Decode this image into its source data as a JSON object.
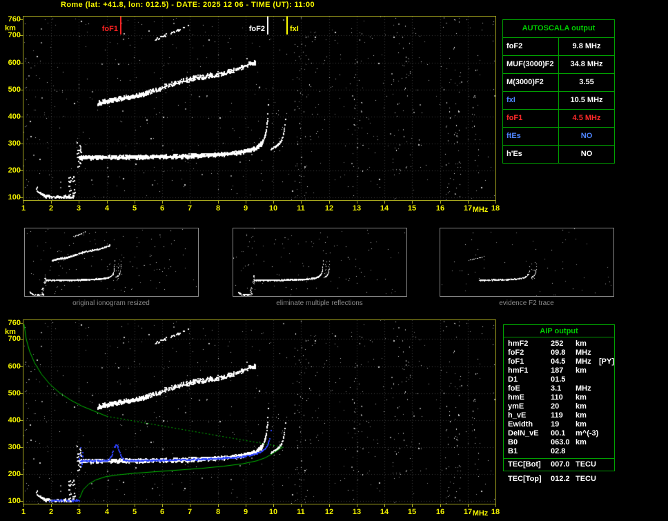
{
  "title": "Rome (lat: +41.8, lon: 012.5) - DATE: 2025 12 06 - TIME (UT): 11:00",
  "colors": {
    "background": "#000000",
    "axis": "#a9a91f",
    "axis_text": "#f2f200",
    "grid": "#3d3d3d",
    "trace_white": "#ffffff",
    "trace_blue": "#2d43ff",
    "profile_green": "#00c000",
    "panel_green": "#00a000",
    "panel_header_green": "#00cc00",
    "red": "#ff2a2a",
    "blue_text": "#4f86ff",
    "caption_gray": "#8a8a8a",
    "title_yellow": "#f8f800"
  },
  "autoscala": {
    "header": "AUTOSCALA output",
    "rows": [
      {
        "label": "foF2",
        "value": "9.8 MHz",
        "label_color": "#ffffff",
        "value_color": "#ffffff"
      },
      {
        "label": "MUF(3000)F2",
        "value": "34.8 MHz",
        "label_color": "#ffffff",
        "value_color": "#ffffff"
      },
      {
        "label": "M(3000)F2",
        "value": "3.55",
        "label_color": "#ffffff",
        "value_color": "#ffffff"
      },
      {
        "label": "fxI",
        "value": "10.5 MHz",
        "label_color": "#4f86ff",
        "value_color": "#ffffff"
      },
      {
        "label": "foF1",
        "value": "4.5 MHz",
        "label_color": "#ff2a2a",
        "value_color": "#ff2a2a"
      },
      {
        "label": "ftEs",
        "value": "NO",
        "label_color": "#4f86ff",
        "value_color": "#4f86ff"
      },
      {
        "label": "h'Es",
        "value": "NO",
        "label_color": "#ffffff",
        "value_color": "#ffffff"
      }
    ]
  },
  "aip": {
    "header": "AIP output",
    "rows": [
      {
        "label": "hmF2",
        "value": "252",
        "unit": "km",
        "extra": ""
      },
      {
        "label": "foF2",
        "value": "09.8",
        "unit": "MHz",
        "extra": ""
      },
      {
        "label": "foF1",
        "value": "04.5",
        "unit": "MHz",
        "extra": "[PY]"
      },
      {
        "label": "hmF1",
        "value": "187",
        "unit": "km",
        "extra": ""
      },
      {
        "label": "D1",
        "value": "01.5",
        "unit": "",
        "extra": ""
      },
      {
        "label": "foE",
        "value": "3.1",
        "unit": "MHz",
        "extra": ""
      },
      {
        "label": "hmE",
        "value": "110",
        "unit": "km",
        "extra": ""
      },
      {
        "label": "ymE",
        "value": "20",
        "unit": "km",
        "extra": ""
      },
      {
        "label": "h_vE",
        "value": "119",
        "unit": "km",
        "extra": ""
      },
      {
        "label": "Ewidth",
        "value": "19",
        "unit": "km",
        "extra": ""
      },
      {
        "label": "DelN_vE",
        "value": "00.1",
        "unit": "m^(-3)",
        "extra": ""
      },
      {
        "label": "B0",
        "value": "063.0",
        "unit": "km",
        "extra": ""
      },
      {
        "label": "B1",
        "value": "02.8",
        "unit": "",
        "extra": ""
      }
    ],
    "tec_rows": [
      {
        "label": "TEC[Bot]",
        "value": "007.0",
        "unit": "TECU"
      },
      {
        "label": "TEC[Top]",
        "value": "012.2",
        "unit": "TECU"
      }
    ]
  },
  "thumbnails": [
    {
      "caption": "original ionogram resized"
    },
    {
      "caption": "eliminate multiple reflections"
    },
    {
      "caption": "evidence F2 trace"
    }
  ],
  "chart_data": {
    "type": "scatter",
    "title": "ionogram",
    "xlabel": "MHz",
    "ylabel": "km",
    "xlim": [
      1,
      18
    ],
    "ylim": [
      90,
      770
    ],
    "x_ticks": [
      1,
      2,
      3,
      4,
      5,
      6,
      7,
      8,
      9,
      10,
      11,
      12,
      13,
      14,
      15,
      16,
      17,
      18
    ],
    "y_ticks": [
      760,
      700,
      600,
      500,
      400,
      300,
      200,
      100
    ],
    "markers": [
      {
        "label": "foF1",
        "f": 4.5,
        "color": "#ff2222",
        "side": "left"
      },
      {
        "label": "foF2",
        "f": 9.8,
        "color": "#ffffff",
        "side": "left"
      },
      {
        "label": "fxI",
        "f": 10.5,
        "color": "#ffff00",
        "side": "right"
      }
    ],
    "foF2_asymptote": 9.82,
    "fxI_asymptote": 10.47,
    "noise_bands": [
      10.9,
      11.2,
      13.05,
      14.45,
      14.8,
      16.25,
      16.6,
      17.3
    ],
    "second_hop": {
      "f_start": 3.65,
      "f_end": 9.35,
      "h_start": 443,
      "h_end": 597
    },
    "third_hop": {
      "f_start": 5.75,
      "f_end": 6.95,
      "h_start": 688,
      "h_end": 736
    },
    "e_region": {
      "f_start": 1.45,
      "f_end": 2.8,
      "h": 103
    },
    "restored_trace": {
      "f_start": 3.05,
      "f_end": 10.1,
      "base": 236,
      "a": 14,
      "fc": 9.95,
      "bump_f": 4.32,
      "bump_amp": 58,
      "bump_w": 0.16,
      "e_f_start": 1.9,
      "e_f_end": 3.05,
      "e_h": 104
    },
    "profile": {
      "topside_solid": [
        [
          1.02,
          755
        ],
        [
          1.1,
          700
        ],
        [
          1.22,
          655
        ],
        [
          1.4,
          612
        ],
        [
          1.65,
          570
        ],
        [
          1.95,
          533
        ],
        [
          2.3,
          501
        ],
        [
          2.7,
          474
        ],
        [
          3.1,
          452
        ],
        [
          3.55,
          433
        ],
        [
          4.0,
          414
        ]
      ],
      "topside_dashed": [
        [
          4.0,
          414
        ],
        [
          10.35,
          300
        ]
      ],
      "bottomside": [
        [
          3.02,
          110
        ],
        [
          3.15,
          142
        ],
        [
          3.35,
          163
        ],
        [
          3.6,
          178
        ],
        [
          3.95,
          190
        ],
        [
          4.4,
          197
        ],
        [
          5.0,
          203
        ],
        [
          5.8,
          209
        ],
        [
          6.6,
          215
        ],
        [
          7.4,
          221
        ],
        [
          8.2,
          229
        ],
        [
          8.9,
          238
        ],
        [
          9.4,
          249
        ],
        [
          9.7,
          260
        ],
        [
          9.95,
          274
        ],
        [
          10.15,
          288
        ],
        [
          10.3,
          297
        ],
        [
          10.36,
          300
        ]
      ]
    }
  }
}
